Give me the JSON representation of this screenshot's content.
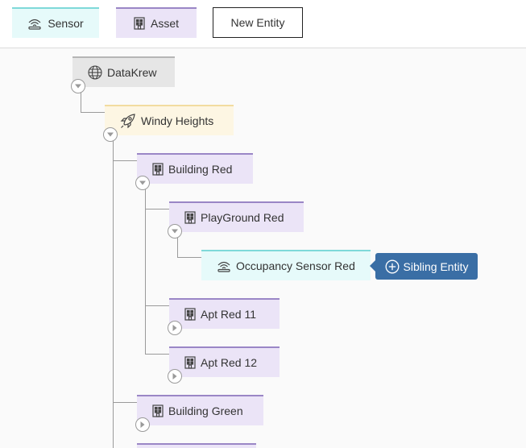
{
  "legend": {
    "sensor_label": "Sensor",
    "asset_label": "Asset",
    "new_entity_label": "New Entity"
  },
  "tree": {
    "datakrew": "DataKrew",
    "windy_heights": "Windy Heights",
    "building_red": "Building Red",
    "playground_red": "PlayGround Red",
    "occupancy_sensor_red": "Occupancy Sensor Red",
    "apt_red_11": "Apt Red 11",
    "apt_red_12": "Apt Red 12",
    "building_green": "Building Green"
  },
  "actions": {
    "sibling_entity_label": "Sibling Entity"
  },
  "colors": {
    "sensor": "#e6fafa",
    "asset": "#ebe4f7",
    "site": "#fdf6e3",
    "organisation": "#e6e6e6",
    "action": "#3a6ea5"
  }
}
